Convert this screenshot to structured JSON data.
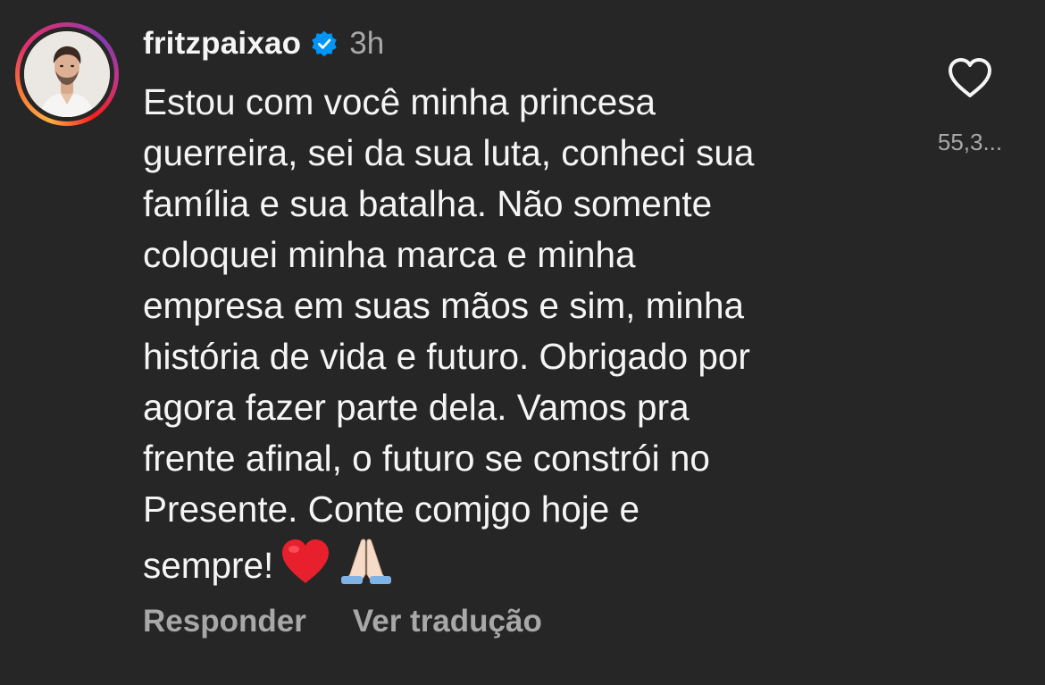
{
  "comment": {
    "username": "fritzpaixao",
    "verified": true,
    "time": "3h",
    "text_lines": [
      "Estou com você minha princesa",
      "guerreira, sei da sua luta, conheci sua",
      "família e sua batalha. Não somente",
      "coloquei minha marca e minha",
      "empresa em suas mãos e sim, minha",
      "história de vida e futuro. Obrigado por",
      "agora fazer parte dela. Vamos pra",
      "frente afinal, o futuro se constrói no",
      "Presente. Conte comjgo hoje e",
      "sempre!"
    ],
    "emojis": [
      "red-heart-icon",
      "folded-hands-icon"
    ],
    "reply_label": "Responder",
    "translate_label": "Ver tradução",
    "like_count": "55,3..."
  },
  "colors": {
    "background": "#262626",
    "text": "#f5f5f5",
    "muted": "#a8a8a8",
    "verified_blue": "#0095f6"
  }
}
